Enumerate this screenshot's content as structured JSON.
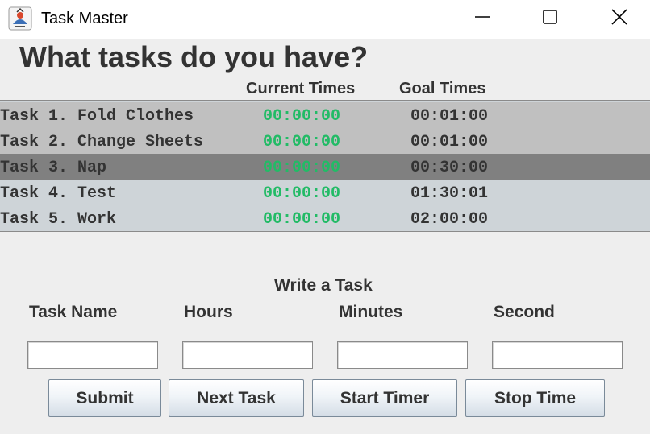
{
  "window": {
    "title": "Task Master"
  },
  "icons": {
    "app": "java-app-icon",
    "minimize": "minimize-icon",
    "maximize": "maximize-icon",
    "close": "close-icon"
  },
  "heading": "What tasks do you have?",
  "columns": {
    "current": "Current Times",
    "goal": "Goal Times"
  },
  "tasks": [
    {
      "name": "Task 1. Fold Clothes",
      "current": "00:00:00",
      "goal": "00:01:00",
      "state": "highlighted"
    },
    {
      "name": "Task 2. Change Sheets",
      "current": "00:00:00",
      "goal": "00:01:00",
      "state": "highlighted"
    },
    {
      "name": "Task 3. Nap",
      "current": "00:00:00",
      "goal": "00:30:00",
      "state": "selected"
    },
    {
      "name": "Task 4. Test",
      "current": "00:00:00",
      "goal": "01:30:01",
      "state": "normal"
    },
    {
      "name": "Task 5. Work",
      "current": "00:00:00",
      "goal": "02:00:00",
      "state": "normal"
    }
  ],
  "row_colors": {
    "highlighted": "#c0c0c0",
    "selected": "#808080",
    "normal": "#ced4d8"
  },
  "form": {
    "title": "Write a Task",
    "task_name_label": "Task Name",
    "hours_label": "Hours",
    "minutes_label": "Minutes",
    "second_label": "Second",
    "task_name_value": "",
    "hours_value": "",
    "minutes_value": "",
    "second_value": ""
  },
  "buttons": {
    "submit": "Submit",
    "next_task": "Next Task",
    "start_timer": "Start Timer",
    "stop_time": "Stop Time"
  }
}
